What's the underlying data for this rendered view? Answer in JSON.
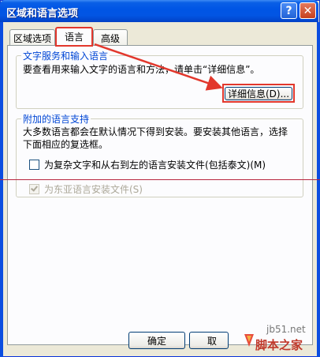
{
  "window": {
    "title": "区域和语言选项"
  },
  "title_buttons": {
    "help_label": "?",
    "close_label": "✕"
  },
  "tabs": [
    {
      "label": "区域选项",
      "selected": false
    },
    {
      "label": "语言",
      "selected": true
    },
    {
      "label": "高级",
      "selected": false
    }
  ],
  "text_services": {
    "title": "文字服务和输入语言",
    "description": "要查看用来输入文字的语言和方法，请单击“详细信息”。",
    "details_button": "详细信息(D)..."
  },
  "supplemental": {
    "title": "附加的语言支持",
    "description_line1": "大多数语言都会在默认情况下得到安装。要安装其他语言，选择",
    "description_line2": "下面相应的复选框。",
    "complex_script_label": "为复杂文字和从右到左的语言安装文件(包括泰文)(M)",
    "complex_script_checked": false,
    "east_asian_label": "为东亚语言安装文件(S)",
    "east_asian_checked": true,
    "east_asian_enabled": false
  },
  "buttons": {
    "ok": "确定",
    "cancel": "取"
  },
  "watermark": {
    "site": "jb51.net",
    "name": "脚本之家"
  },
  "colors": {
    "highlight": "#e2372c",
    "titlebar": "#0055e5",
    "group_title": "#0046d5"
  }
}
